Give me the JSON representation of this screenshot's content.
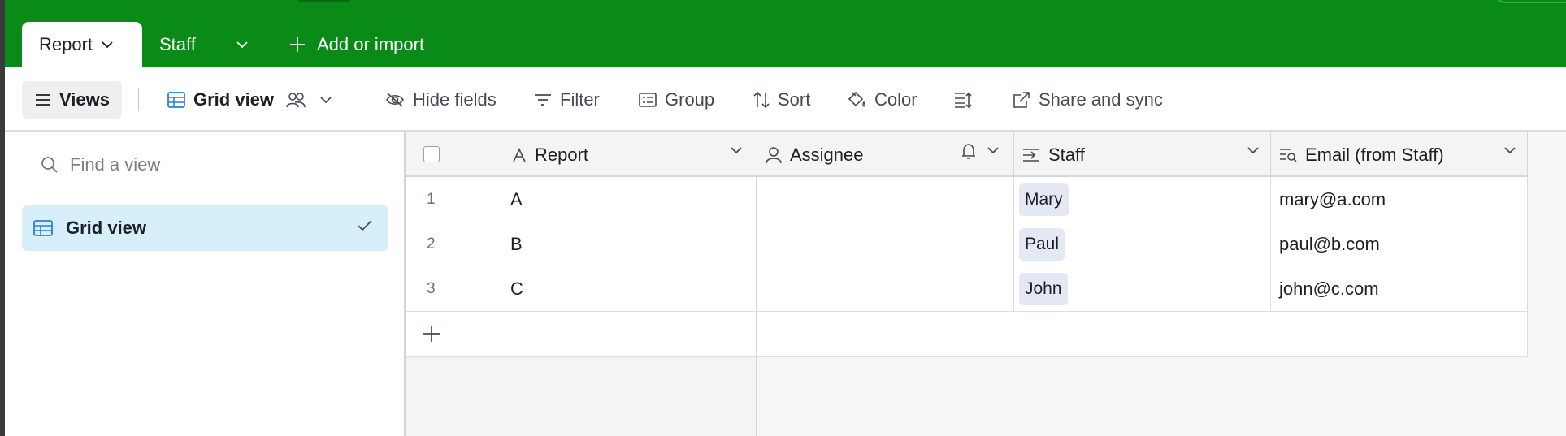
{
  "tabs": {
    "active": "Report",
    "staff": "Staff",
    "add": "Add or import"
  },
  "toolbar": {
    "views": "Views",
    "grid_view": "Grid view",
    "hide_fields": "Hide fields",
    "filter": "Filter",
    "group": "Group",
    "sort": "Sort",
    "color": "Color",
    "share": "Share and sync"
  },
  "sidebar": {
    "search_placeholder": "Find a view",
    "items": [
      {
        "label": "Grid view",
        "selected": true
      }
    ]
  },
  "grid": {
    "columns": [
      "Report",
      "Assignee",
      "Staff",
      "Email (from Staff)"
    ],
    "rows": [
      {
        "num": "1",
        "report": "A",
        "assignee": "",
        "staff": "Mary",
        "email": "mary@a.com"
      },
      {
        "num": "2",
        "report": "B",
        "assignee": "",
        "staff": "Paul",
        "email": "paul@b.com"
      },
      {
        "num": "3",
        "report": "C",
        "assignee": "",
        "staff": "John",
        "email": "john@c.com"
      }
    ]
  },
  "colors": {
    "brand_green": "#0a8a16",
    "selected_bg": "#d6effa",
    "chip_bg": "#e4e8f5",
    "grid_icon_blue": "#2d7fd3"
  }
}
